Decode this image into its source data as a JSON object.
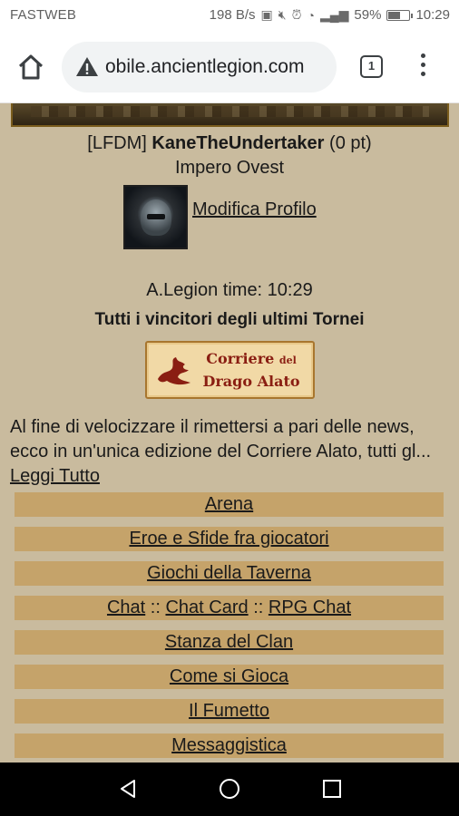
{
  "status": {
    "carrier": "FASTWEB",
    "speed": "198 B/s",
    "battery": "59%",
    "battery_level": 0.59,
    "time": "10:29"
  },
  "browser": {
    "url": "obile.ancientlegion.com",
    "tab_count": "1"
  },
  "profile": {
    "tag": "[LFDM]",
    "name": "KaneTheUndertaker",
    "points": "(0 pt)",
    "empire": "Impero Ovest",
    "edit_link": "Modifica Profilo"
  },
  "game": {
    "time_label": "A.Legion time: 10:29",
    "winners_heading": "Tutti i vincitori degli ultimi Tornei"
  },
  "corriere": {
    "line1": "Corriere",
    "line1_small": "del",
    "line2": "Drago Alato"
  },
  "news": {
    "text": "Al fine di velocizzare il rimettersi a pari delle news, ecco in un'unica edizione del Corriere Alato, tutti gl... ",
    "read_more": "Leggi Tutto"
  },
  "menu": {
    "arena": "Arena",
    "eroe": "Eroe e Sfide fra giocatori",
    "giochi": "Giochi della Taverna",
    "chat": "Chat",
    "chat_sep1": "::",
    "chat_card": "Chat Card",
    "chat_sep2": "::",
    "rpg_chat": "RPG Chat",
    "clan": "Stanza del Clan",
    "come": "Come si Gioca",
    "fumetto": "Il Fumetto",
    "messaggistica": "Messaggistica"
  }
}
